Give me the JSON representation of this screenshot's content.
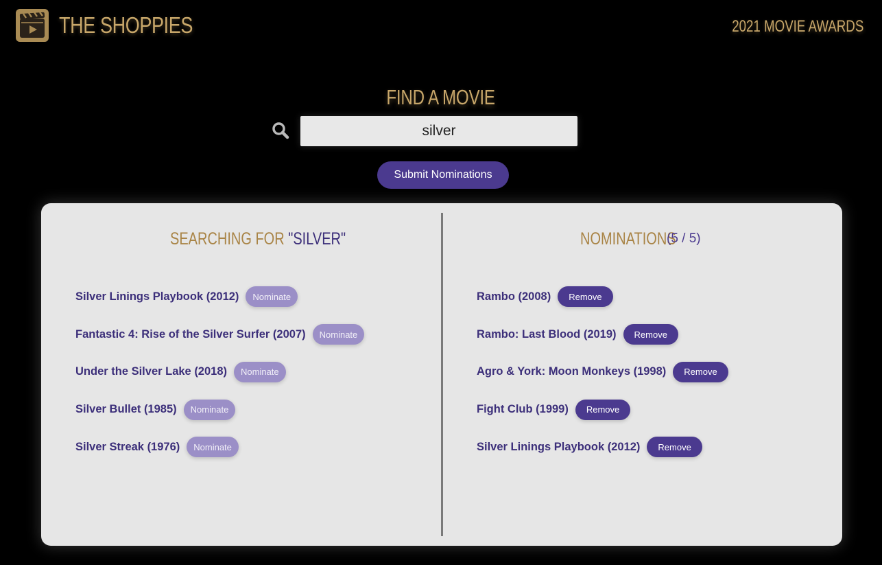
{
  "header": {
    "brand": "THE SHOPPIES",
    "subtitle": "2021 MOVIE AWARDS",
    "logo_icon": "clapperboard-play-icon"
  },
  "search": {
    "heading": "FIND A MOVIE",
    "value": "silver",
    "icon": "search-icon",
    "submit_label": "Submit Nominations"
  },
  "results": {
    "heading_prefix": "SEARCHING FOR ",
    "heading_query": "\"SILVER\"",
    "button_label": "Nominate",
    "items": [
      {
        "title": "Silver Linings Playbook (2012)"
      },
      {
        "title": "Fantastic 4: Rise of the Silver Surfer (2007)"
      },
      {
        "title": "Under the Silver Lake (2018)"
      },
      {
        "title": "Silver Bullet (1985)"
      },
      {
        "title": "Silver Streak (1976)"
      }
    ]
  },
  "nominations": {
    "heading": "NOMINATIONS",
    "count": "(5 / 5)",
    "button_label": "Remove",
    "items": [
      {
        "title": "Rambo (2008)"
      },
      {
        "title": "Rambo: Last Blood (2019)"
      },
      {
        "title": "Agro & York: Moon Monkeys (1998)"
      },
      {
        "title": "Fight Club (1999)"
      },
      {
        "title": "Silver Linings Playbook (2012)"
      }
    ]
  },
  "colors": {
    "gold": "#c8a76a",
    "purple": "#4b3a8f",
    "panel": "#e6e6e6",
    "background": "#000000"
  }
}
